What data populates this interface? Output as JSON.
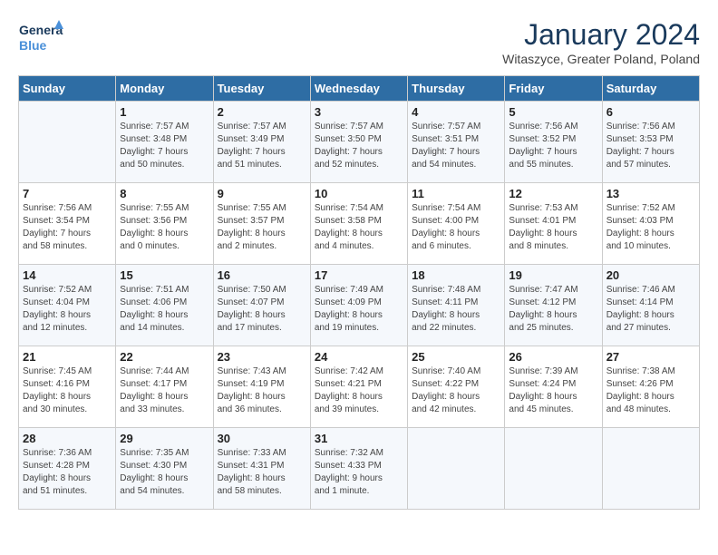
{
  "header": {
    "logo_line1": "General",
    "logo_line2": "Blue",
    "month_title": "January 2024",
    "subtitle": "Witaszyce, Greater Poland, Poland"
  },
  "days_of_week": [
    "Sunday",
    "Monday",
    "Tuesday",
    "Wednesday",
    "Thursday",
    "Friday",
    "Saturday"
  ],
  "weeks": [
    [
      {
        "day": "",
        "info": ""
      },
      {
        "day": "1",
        "info": "Sunrise: 7:57 AM\nSunset: 3:48 PM\nDaylight: 7 hours\nand 50 minutes."
      },
      {
        "day": "2",
        "info": "Sunrise: 7:57 AM\nSunset: 3:49 PM\nDaylight: 7 hours\nand 51 minutes."
      },
      {
        "day": "3",
        "info": "Sunrise: 7:57 AM\nSunset: 3:50 PM\nDaylight: 7 hours\nand 52 minutes."
      },
      {
        "day": "4",
        "info": "Sunrise: 7:57 AM\nSunset: 3:51 PM\nDaylight: 7 hours\nand 54 minutes."
      },
      {
        "day": "5",
        "info": "Sunrise: 7:56 AM\nSunset: 3:52 PM\nDaylight: 7 hours\nand 55 minutes."
      },
      {
        "day": "6",
        "info": "Sunrise: 7:56 AM\nSunset: 3:53 PM\nDaylight: 7 hours\nand 57 minutes."
      }
    ],
    [
      {
        "day": "7",
        "info": "Sunrise: 7:56 AM\nSunset: 3:54 PM\nDaylight: 7 hours\nand 58 minutes."
      },
      {
        "day": "8",
        "info": "Sunrise: 7:55 AM\nSunset: 3:56 PM\nDaylight: 8 hours\nand 0 minutes."
      },
      {
        "day": "9",
        "info": "Sunrise: 7:55 AM\nSunset: 3:57 PM\nDaylight: 8 hours\nand 2 minutes."
      },
      {
        "day": "10",
        "info": "Sunrise: 7:54 AM\nSunset: 3:58 PM\nDaylight: 8 hours\nand 4 minutes."
      },
      {
        "day": "11",
        "info": "Sunrise: 7:54 AM\nSunset: 4:00 PM\nDaylight: 8 hours\nand 6 minutes."
      },
      {
        "day": "12",
        "info": "Sunrise: 7:53 AM\nSunset: 4:01 PM\nDaylight: 8 hours\nand 8 minutes."
      },
      {
        "day": "13",
        "info": "Sunrise: 7:52 AM\nSunset: 4:03 PM\nDaylight: 8 hours\nand 10 minutes."
      }
    ],
    [
      {
        "day": "14",
        "info": "Sunrise: 7:52 AM\nSunset: 4:04 PM\nDaylight: 8 hours\nand 12 minutes."
      },
      {
        "day": "15",
        "info": "Sunrise: 7:51 AM\nSunset: 4:06 PM\nDaylight: 8 hours\nand 14 minutes."
      },
      {
        "day": "16",
        "info": "Sunrise: 7:50 AM\nSunset: 4:07 PM\nDaylight: 8 hours\nand 17 minutes."
      },
      {
        "day": "17",
        "info": "Sunrise: 7:49 AM\nSunset: 4:09 PM\nDaylight: 8 hours\nand 19 minutes."
      },
      {
        "day": "18",
        "info": "Sunrise: 7:48 AM\nSunset: 4:11 PM\nDaylight: 8 hours\nand 22 minutes."
      },
      {
        "day": "19",
        "info": "Sunrise: 7:47 AM\nSunset: 4:12 PM\nDaylight: 8 hours\nand 25 minutes."
      },
      {
        "day": "20",
        "info": "Sunrise: 7:46 AM\nSunset: 4:14 PM\nDaylight: 8 hours\nand 27 minutes."
      }
    ],
    [
      {
        "day": "21",
        "info": "Sunrise: 7:45 AM\nSunset: 4:16 PM\nDaylight: 8 hours\nand 30 minutes."
      },
      {
        "day": "22",
        "info": "Sunrise: 7:44 AM\nSunset: 4:17 PM\nDaylight: 8 hours\nand 33 minutes."
      },
      {
        "day": "23",
        "info": "Sunrise: 7:43 AM\nSunset: 4:19 PM\nDaylight: 8 hours\nand 36 minutes."
      },
      {
        "day": "24",
        "info": "Sunrise: 7:42 AM\nSunset: 4:21 PM\nDaylight: 8 hours\nand 39 minutes."
      },
      {
        "day": "25",
        "info": "Sunrise: 7:40 AM\nSunset: 4:22 PM\nDaylight: 8 hours\nand 42 minutes."
      },
      {
        "day": "26",
        "info": "Sunrise: 7:39 AM\nSunset: 4:24 PM\nDaylight: 8 hours\nand 45 minutes."
      },
      {
        "day": "27",
        "info": "Sunrise: 7:38 AM\nSunset: 4:26 PM\nDaylight: 8 hours\nand 48 minutes."
      }
    ],
    [
      {
        "day": "28",
        "info": "Sunrise: 7:36 AM\nSunset: 4:28 PM\nDaylight: 8 hours\nand 51 minutes."
      },
      {
        "day": "29",
        "info": "Sunrise: 7:35 AM\nSunset: 4:30 PM\nDaylight: 8 hours\nand 54 minutes."
      },
      {
        "day": "30",
        "info": "Sunrise: 7:33 AM\nSunset: 4:31 PM\nDaylight: 8 hours\nand 58 minutes."
      },
      {
        "day": "31",
        "info": "Sunrise: 7:32 AM\nSunset: 4:33 PM\nDaylight: 9 hours\nand 1 minute."
      },
      {
        "day": "",
        "info": ""
      },
      {
        "day": "",
        "info": ""
      },
      {
        "day": "",
        "info": ""
      }
    ]
  ]
}
